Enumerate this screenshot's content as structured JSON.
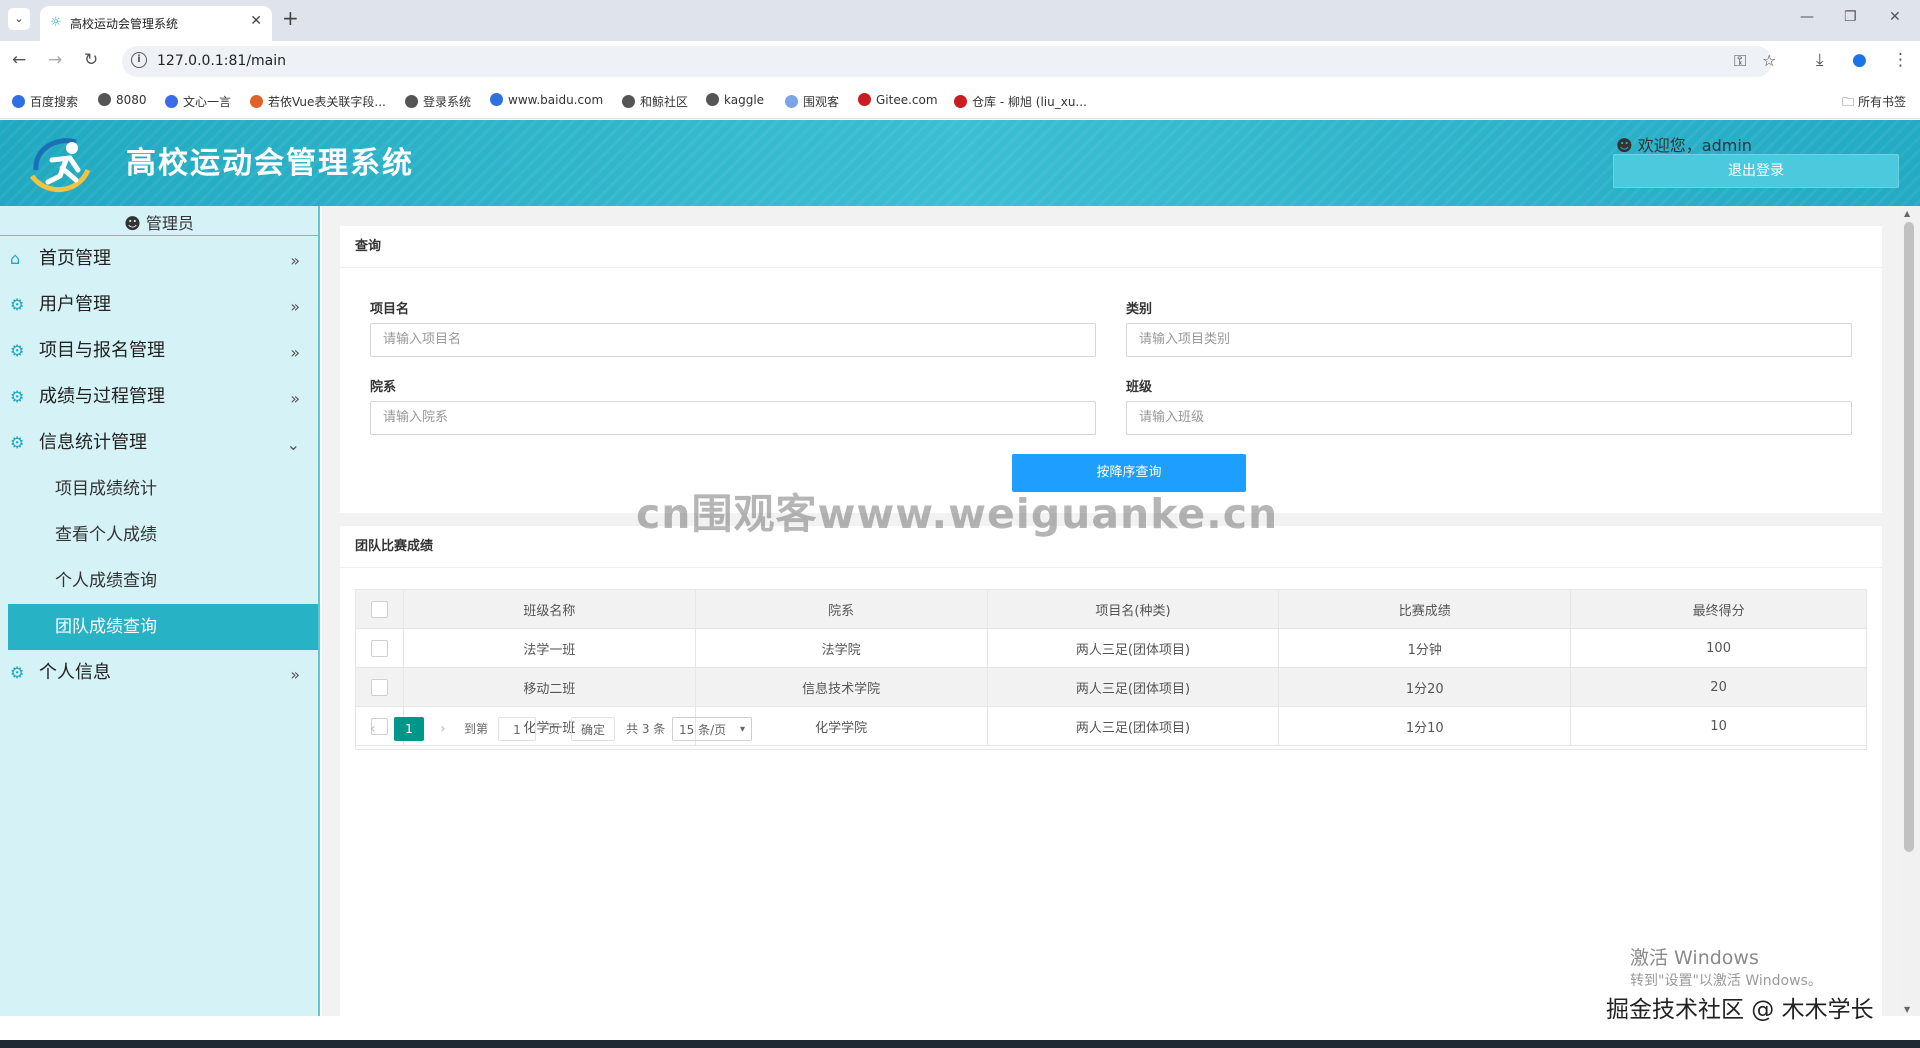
{
  "browser": {
    "tab_title": "高校运动会管理系统",
    "url": "127.0.0.1:81/main",
    "bookmarks": [
      {
        "label": "百度搜索",
        "color": "#2f6fe0"
      },
      {
        "label": "8080",
        "color": "#555555"
      },
      {
        "label": "文心一言",
        "color": "#3a6be8"
      },
      {
        "label": "若依Vue表关联字段...",
        "color": "#e0622a"
      },
      {
        "label": "登录系统",
        "color": "#555555"
      },
      {
        "label": "www.baidu.com",
        "color": "#2f6fe0"
      },
      {
        "label": "和鲸社区",
        "color": "#555555"
      },
      {
        "label": "kaggle",
        "color": "#555555"
      },
      {
        "label": "围观客",
        "color": "#7aa6e8"
      },
      {
        "label": "Gitee.com",
        "color": "#c71d23"
      },
      {
        "label": "仓库 - 柳旭 (liu_xu...",
        "color": "#c71d23"
      }
    ],
    "bookmarks_folder": "所有书签"
  },
  "header": {
    "title": "高校运动会管理系统",
    "welcome": "欢迎您，admin",
    "logout": "退出登录"
  },
  "sidebar": {
    "role": "管理员",
    "items": [
      {
        "label": "首页管理",
        "icon": "home-icon",
        "expanded": false
      },
      {
        "label": "用户管理",
        "icon": "gear-icon",
        "expanded": false
      },
      {
        "label": "项目与报名管理",
        "icon": "gear-icon",
        "expanded": false
      },
      {
        "label": "成绩与过程管理",
        "icon": "gear-icon",
        "expanded": false
      },
      {
        "label": "信息统计管理",
        "icon": "gear-icon",
        "expanded": true
      },
      {
        "label": "个人信息",
        "icon": "gear-icon",
        "expanded": false
      }
    ],
    "subitems": [
      {
        "label": "项目成绩统计",
        "active": false
      },
      {
        "label": "查看个人成绩",
        "active": false
      },
      {
        "label": "个人成绩查询",
        "active": false
      },
      {
        "label": "团队成绩查询",
        "active": true
      }
    ]
  },
  "query": {
    "title": "查询",
    "fields": [
      {
        "label": "项目名",
        "placeholder": "请输入项目名"
      },
      {
        "label": "类别",
        "placeholder": "请输入项目类别"
      },
      {
        "label": "院系",
        "placeholder": "请输入院系"
      },
      {
        "label": "班级",
        "placeholder": "请输入班级"
      }
    ],
    "button": "按降序查询"
  },
  "results": {
    "title": "团队比赛成绩",
    "columns": [
      "班级名称",
      "院系",
      "项目名(种类)",
      "比赛成绩",
      "最终得分"
    ],
    "rows": [
      [
        "法学一班",
        "法学院",
        "两人三足(团体项目)",
        "1分钟",
        "100"
      ],
      [
        "移动二班",
        "信息技术学院",
        "两人三足(团体项目)",
        "1分20",
        "20"
      ],
      [
        "化学一班",
        "化学学院",
        "两人三足(团体项目)",
        "1分10",
        "10"
      ]
    ],
    "pager": {
      "current": "1",
      "goto_label": "到第",
      "page_input": "1",
      "page_suffix": "页",
      "confirm": "确定",
      "total": "共 3 条",
      "per_page": "15 条/页"
    }
  },
  "overlay": {
    "watermark": "cn围观客www.weiguanke.cn",
    "activate_title": "激活 Windows",
    "activate_hint": "转到\"设置\"以激活 Windows。",
    "community": "掘金技术社区 @ 木木学长"
  },
  "colors": {
    "accent": "#27b2c6",
    "search_button": "#1e9fff",
    "pager_current": "#009688",
    "sidebar_bg": "#d5f2f6"
  }
}
